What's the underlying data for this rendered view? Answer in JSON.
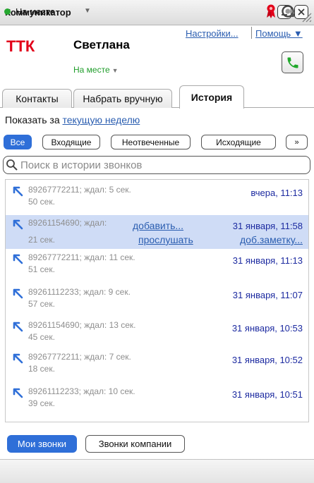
{
  "window": {
    "title": "Коммуникатор"
  },
  "header": {
    "logo_text": "ТТК",
    "user_name": "Светлана",
    "presence": "На месте",
    "settings_link": "Настройки...",
    "help_link": "Помощь ▼"
  },
  "tabs": [
    {
      "label": "Контакты"
    },
    {
      "label": "Набрать вручную"
    },
    {
      "label": "История",
      "active": true
    }
  ],
  "period": {
    "prefix": "Показать за",
    "link": "текущую неделю"
  },
  "filters": [
    {
      "label": "Все",
      "active": true
    },
    {
      "label": "Входящие"
    },
    {
      "label": "Неотвеченные"
    },
    {
      "label": "Исходящие"
    },
    {
      "label": "»"
    }
  ],
  "search": {
    "placeholder": "Поиск в истории звонков"
  },
  "history": [
    {
      "number": "89267772211; ждал: 5 сек.",
      "duration": "50 сек.",
      "when": "вчера, 11:13"
    },
    {
      "number": "89261154690; ждал:",
      "duration": "21 сек.",
      "when": "31 января, 11:58",
      "selected": true,
      "add_link": "добавить...",
      "listen_link": "прослушать",
      "note_link": "доб.заметку..."
    },
    {
      "number": "89267772211; ждал: 11 сек.",
      "duration": "51 сек.",
      "when": "31 января, 11:13"
    },
    {
      "number": "89261112233; ждал: 9 сек.",
      "duration": "57 сек.",
      "when": "31 января, 11:07"
    },
    {
      "number": "89261154690; ждал: 13 сек.",
      "duration": "45 сек.",
      "when": "31 января, 10:53"
    },
    {
      "number": "89267772211; ждал: 7 сек.",
      "duration": "18 сек.",
      "when": "31 января, 10:52"
    },
    {
      "number": "89261112233; ждал: 10 сек.",
      "duration": "39 сек.",
      "when": "31 января, 10:51"
    }
  ],
  "bottom": {
    "my_calls": "Мои звонки",
    "company_calls": "Звонки компании"
  },
  "status": {
    "text": "На месте",
    "color": "#26a830"
  },
  "colors": {
    "accent": "#2f6fd8",
    "link": "#2a5db0",
    "brand": "#e2001a",
    "date": "#1c2aa0"
  },
  "icons": [
    "minimize-icon",
    "close-icon",
    "phone-icon",
    "search-icon",
    "call-arrow-icon",
    "ribbon-icon",
    "headset-icon",
    "resize-grip-icon"
  ]
}
